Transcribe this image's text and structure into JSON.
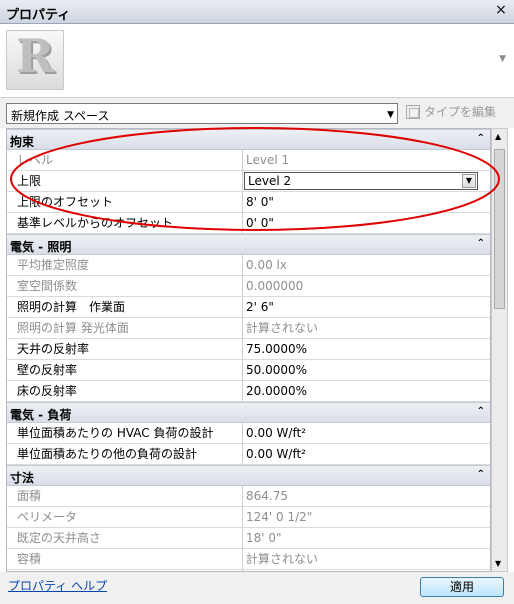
{
  "window": {
    "title": "プロパティ",
    "close_label": "×"
  },
  "type_selector": {
    "value": "新規作成 スペース",
    "edit_type_label": "タイプを編集"
  },
  "groups": [
    {
      "name": "拘束",
      "rows": [
        {
          "name": "レベル",
          "value": "Level 1",
          "dim": true
        },
        {
          "name": "上限",
          "value": "Level 2",
          "dropdown": true
        },
        {
          "name": "上限のオフセット",
          "value": "8'  0\""
        },
        {
          "name": "基準レベルからのオフセット",
          "value": "0'  0\""
        }
      ]
    },
    {
      "name": "電気 - 照明",
      "rows": [
        {
          "name": "平均推定照度",
          "value": "0.00 lx",
          "dim": true
        },
        {
          "name": "室空間係数",
          "value": "0.000000",
          "dim": true
        },
        {
          "name": "照明の計算　作業面",
          "value": "2'  6\""
        },
        {
          "name": "照明の計算 発光体面",
          "value": "計算されない",
          "dim": true
        },
        {
          "name": "天井の反射率",
          "value": "75.0000%"
        },
        {
          "name": "壁の反射率",
          "value": "50.0000%"
        },
        {
          "name": "床の反射率",
          "value": "20.0000%"
        }
      ]
    },
    {
      "name": "電気 - 負荷",
      "rows": [
        {
          "name": "単位面積あたりの HVAC 負荷の設計",
          "value": "0.00 W/ft²"
        },
        {
          "name": "単位面積あたりの他の負荷の設計",
          "value": "0.00 W/ft²"
        }
      ]
    },
    {
      "name": "寸法",
      "rows": [
        {
          "name": "面積",
          "value": "864.75",
          "dim": true
        },
        {
          "name": "ペリメータ",
          "value": "124'  0 1/2\"",
          "dim": true
        },
        {
          "name": "既定の天井高さ",
          "value": "18'  0\"",
          "dim": true
        },
        {
          "name": "容積",
          "value": "計算されない",
          "dim": true
        },
        {
          "name": "",
          "value": "",
          "dim": true
        }
      ]
    }
  ],
  "footer": {
    "help_label": "プロパティ ヘルプ",
    "apply_label": "適用"
  },
  "colors": {
    "annotation": "#e00000",
    "title_bar": "#d8dee8",
    "link": "#0645ad"
  },
  "icons": {
    "close": "close-icon",
    "revit_logo": "revit-logo",
    "edit_type": "edit-type-icon"
  }
}
